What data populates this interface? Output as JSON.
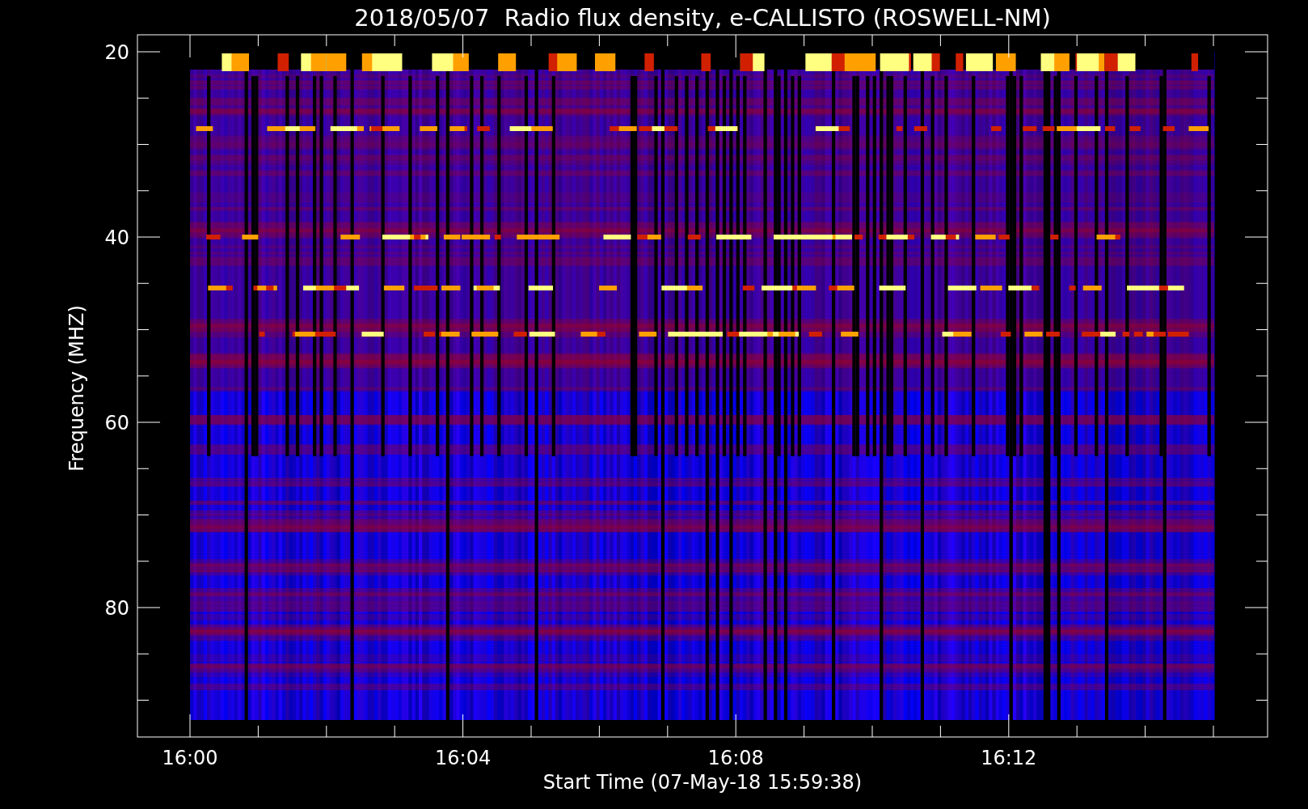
{
  "title": "2018/05/07  Radio flux density, e-CALLISTO (ROSWELL-NM)",
  "y_axis": {
    "label": "Frequency (MHZ)",
    "tick_labels": [
      "20",
      "40",
      "60",
      "80"
    ]
  },
  "x_axis": {
    "label": "Start Time (07-May-18 15:59:38)",
    "tick_labels": [
      "16:00",
      "16:04",
      "16:08",
      "16:12"
    ]
  }
}
